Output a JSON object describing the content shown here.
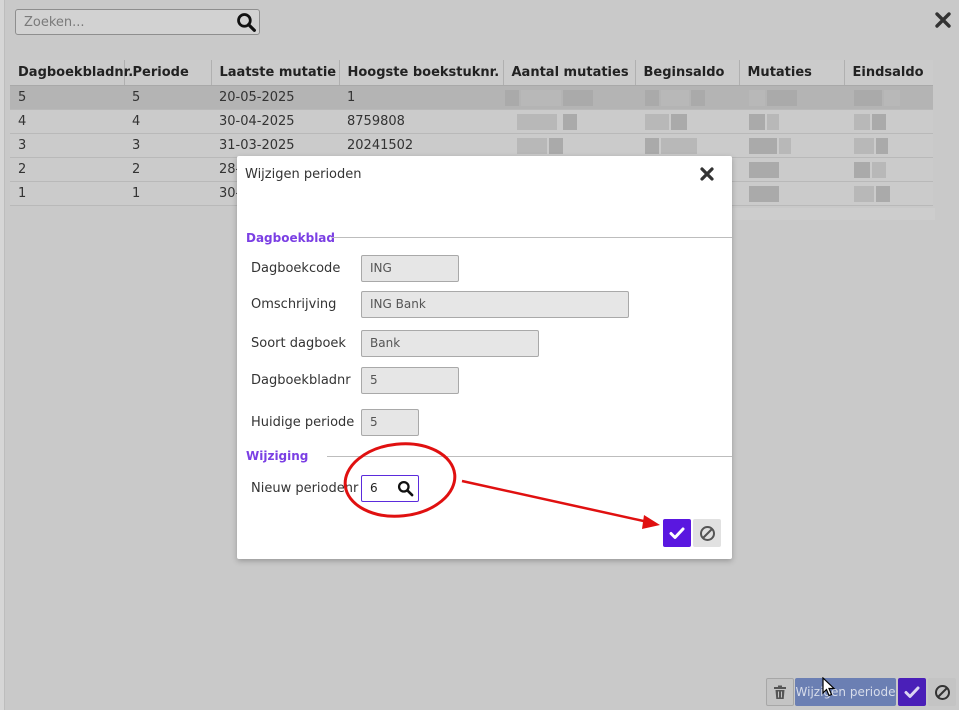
{
  "search": {
    "placeholder": "Zoeken..."
  },
  "table": {
    "columns": [
      "Dagboekbladnr.",
      "Periode",
      "Laatste mutatie",
      "Hoogste boekstuknr.",
      "Aantal mutaties",
      "Beginsaldo",
      "Mutaties",
      "Eindsaldo"
    ],
    "rows": [
      {
        "nr": "5",
        "periode": "5",
        "laatste": "20-05-2025",
        "hoogste": "1"
      },
      {
        "nr": "4",
        "periode": "4",
        "laatste": "30-04-2025",
        "hoogste": "8759808"
      },
      {
        "nr": "3",
        "periode": "3",
        "laatste": "31-03-2025",
        "hoogste": "20241502"
      },
      {
        "nr": "2",
        "periode": "2",
        "laatste": "28-",
        "hoogste": ""
      },
      {
        "nr": "1",
        "periode": "1",
        "laatste": "30-",
        "hoogste": ""
      }
    ]
  },
  "modal": {
    "title": "Wijzigen perioden",
    "section_dagboekblad": "Dagboekblad",
    "section_wijziging": "Wijziging",
    "labels": {
      "dagboekcode": "Dagboekcode",
      "omschrijving": "Omschrijving",
      "soort": "Soort dagboek",
      "bladnr": "Dagboekbladnr",
      "huidige": "Huidige periode",
      "nieuw": "Nieuw periodenr"
    },
    "values": {
      "dagboekcode": "ING",
      "omschrijving": "ING Bank",
      "soort": "Bank",
      "bladnr": "5",
      "huidige": "5",
      "nieuw": "6"
    }
  },
  "toolbar": {
    "wijzig_label": "Wijzigen periode"
  },
  "colors": {
    "accent": "#5a17e0",
    "section": "#7b3fe4",
    "annotation": "#e01010"
  }
}
